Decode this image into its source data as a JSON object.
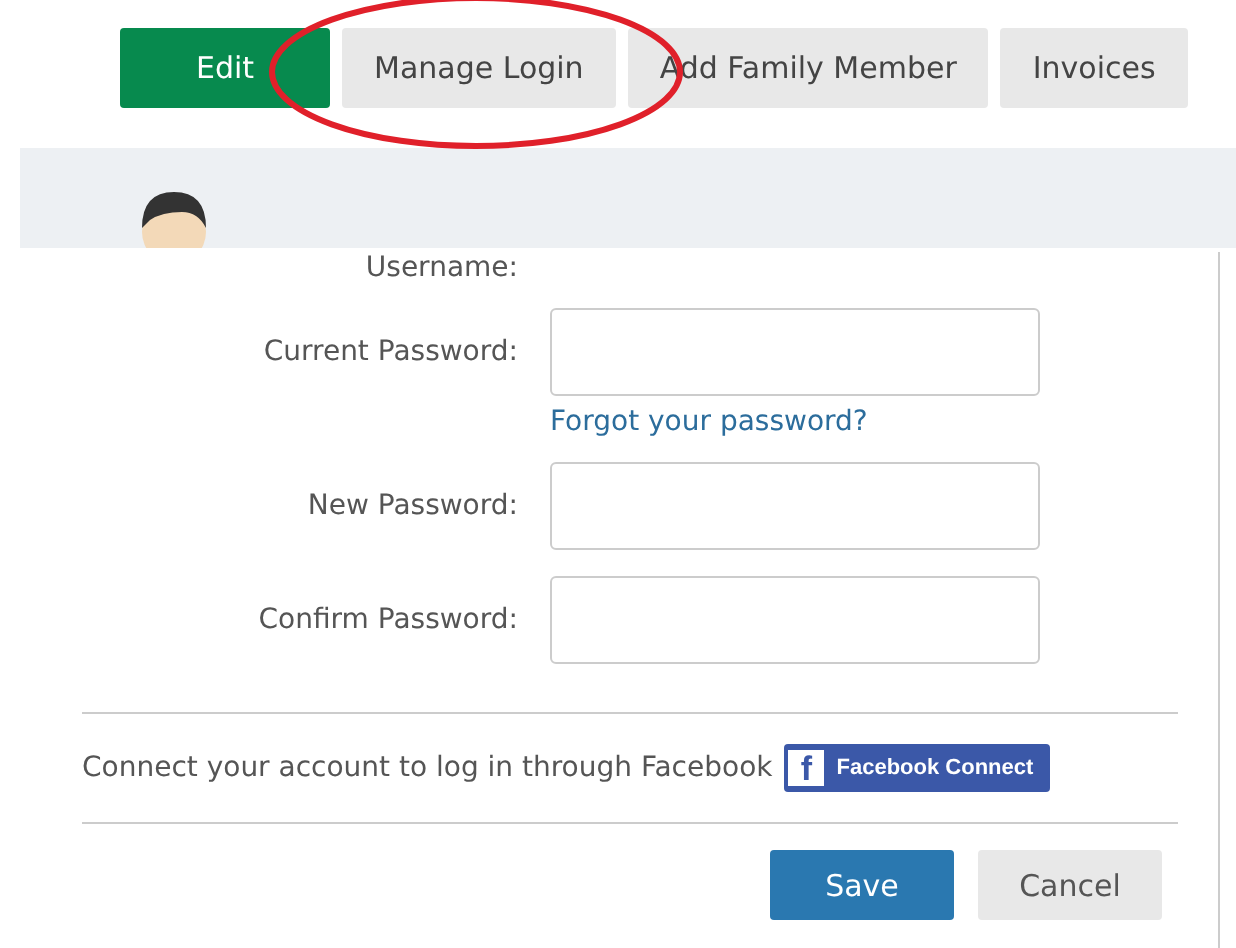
{
  "tabs": [
    {
      "label": "Edit",
      "selected": true
    },
    {
      "label": "Manage Login",
      "selected": false
    },
    {
      "label": "Add Family Member",
      "selected": false
    },
    {
      "label": "Invoices",
      "selected": false
    }
  ],
  "form": {
    "fields": [
      {
        "label": "Username:",
        "kind": "text"
      },
      {
        "label": "Current Password:",
        "kind": "input",
        "link": "Forgot your password?"
      },
      {
        "label": "New Password:",
        "kind": "input"
      },
      {
        "label": "Confirm Password:",
        "kind": "input"
      }
    ]
  },
  "facebook": {
    "text": "Connect your account to log in through Facebook",
    "button": "Facebook Connect",
    "icon": "f"
  },
  "buttons": [
    {
      "label": "Save",
      "kind": "primary"
    },
    {
      "label": "Cancel",
      "kind": "secondary"
    }
  ]
}
